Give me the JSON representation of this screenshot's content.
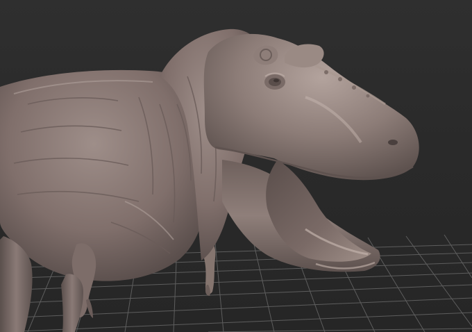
{
  "viewport": {
    "background_color": "#2c2c2c",
    "grid_color": "#6a6a6a",
    "model_color": "#8a7a76",
    "model_highlight_color": "#c4b5af",
    "model_shadow_color": "#4e4442"
  },
  "model": {
    "icon": "t-rex-sculpt-model"
  }
}
